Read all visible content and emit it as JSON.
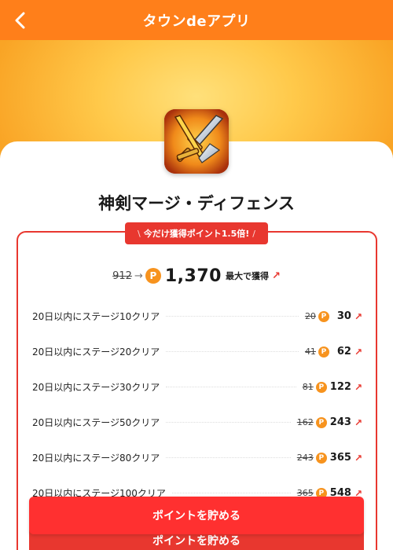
{
  "header": {
    "title": "タウンdeアプリ",
    "back_icon": "chevron-left-icon"
  },
  "app": {
    "name": "神剣マージ・ディフェンス",
    "icon": "crossed-swords-icon"
  },
  "promo": {
    "badge": "今だけ獲得ポイント1.5倍!"
  },
  "total": {
    "old": "912",
    "new": "1,370",
    "suffix": "最大で獲得",
    "coin": "P"
  },
  "missions": [
    {
      "label": "20日以内にステージ10クリア",
      "old": "20",
      "new": "30"
    },
    {
      "label": "20日以内にステージ20クリア",
      "old": "41",
      "new": "62"
    },
    {
      "label": "20日以内にステージ30クリア",
      "old": "81",
      "new": "122"
    },
    {
      "label": "20日以内にステージ50クリア",
      "old": "162",
      "new": "243"
    },
    {
      "label": "20日以内にステージ80クリア",
      "old": "243",
      "new": "365"
    },
    {
      "label": "20日以内にステージ100クリア",
      "old": "365",
      "new": "548"
    }
  ],
  "cta": {
    "label": "ポイントを貯める"
  },
  "colors": {
    "header": "#ff7f1a",
    "accent": "#e8372f",
    "coin": "#f7931e"
  }
}
